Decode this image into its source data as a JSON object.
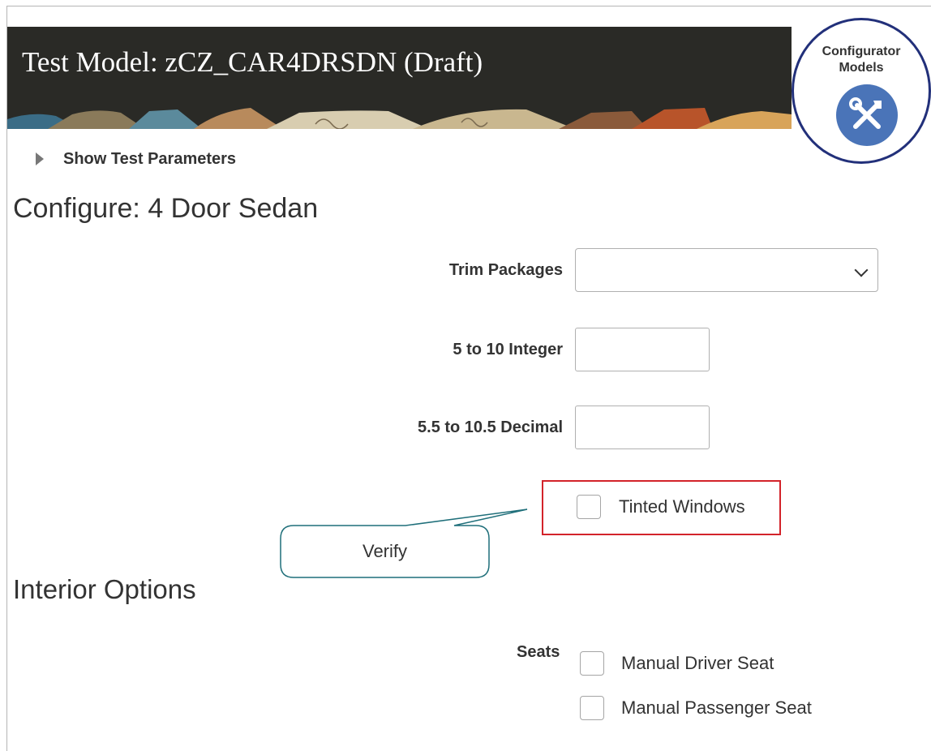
{
  "banner": {
    "title": "Test Model: zCZ_CAR4DRSDN (Draft)"
  },
  "badge": {
    "line1": "Configurator",
    "line2": "Models",
    "icon": "tools-icon"
  },
  "test_params": {
    "label": "Show Test Parameters"
  },
  "configure_title": "Configure: 4 Door Sedan",
  "fields": {
    "trim_packages": {
      "label": "Trim Packages",
      "value": ""
    },
    "integer": {
      "label": "5 to 10 Integer",
      "value": ""
    },
    "decimal": {
      "label": "5.5 to 10.5 Decimal",
      "value": ""
    }
  },
  "tinted_windows": {
    "label": "Tinted Windows",
    "checked": false
  },
  "callout": {
    "text": "Verify"
  },
  "interior": {
    "title": "Interior Options",
    "seats_label": "Seats",
    "options": [
      "Manual Driver Seat",
      "Manual Passenger Seat"
    ]
  },
  "colors": {
    "highlight": "#d3232a",
    "callout_border": "#1f6f7a",
    "badge_ring": "#22307a",
    "badge_icon_bg": "#4a74b8"
  }
}
